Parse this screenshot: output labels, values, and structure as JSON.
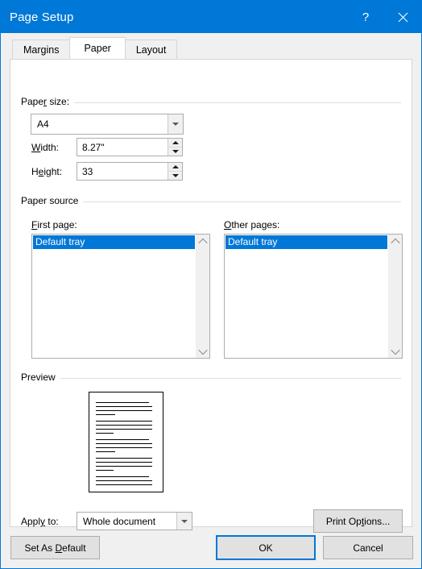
{
  "window": {
    "title": "Page Setup",
    "help_label": "?",
    "close_label": "✕"
  },
  "tabs": [
    {
      "label": "Margins",
      "selected": false
    },
    {
      "label": "Paper",
      "selected": true
    },
    {
      "label": "Layout",
      "selected": false
    }
  ],
  "paper_size": {
    "group_label_pre": "Pape",
    "group_label_acc": "r",
    "group_label_post": " size:",
    "group_label_full": "Paper size:",
    "size_value": "A4",
    "width": {
      "label_acc": "W",
      "label_post": "idth:",
      "label_full": "Width:",
      "value": "8.27\""
    },
    "height": {
      "label_pre": "H",
      "label_acc": "e",
      "label_post": "ight:",
      "label_full": "Height:",
      "value": "33"
    }
  },
  "paper_source": {
    "group_label": "Paper source",
    "first_page": {
      "label_acc": "F",
      "label_post": "irst page:",
      "label_full": "First page:",
      "items": [
        "Default tray"
      ],
      "selected": "Default tray"
    },
    "other_pages": {
      "label_acc": "O",
      "label_post": "ther pages:",
      "label_full": "Other pages:",
      "items": [
        "Default tray"
      ],
      "selected": "Default tray"
    }
  },
  "preview": {
    "group_label": "Preview"
  },
  "apply": {
    "label_pre": "Appl",
    "label_acc": "y",
    "label_post": " to:",
    "label_full": "Apply to:",
    "value": "Whole document",
    "print_options_pre": "Print Op",
    "print_options_acc": "t",
    "print_options_post": "ions...",
    "print_options_full": "Print Options..."
  },
  "footer": {
    "set_default_pre": "Set As ",
    "set_default_acc": "D",
    "set_default_post": "efault",
    "set_default_full": "Set As Default",
    "ok_label": "OK",
    "cancel_label": "Cancel"
  },
  "colors": {
    "titlebar": "#0078d7",
    "selection": "#0078d7",
    "dialog_bg": "#f0f0f0",
    "page_bg": "#ffffff",
    "button_bg": "#e1e1e1"
  }
}
